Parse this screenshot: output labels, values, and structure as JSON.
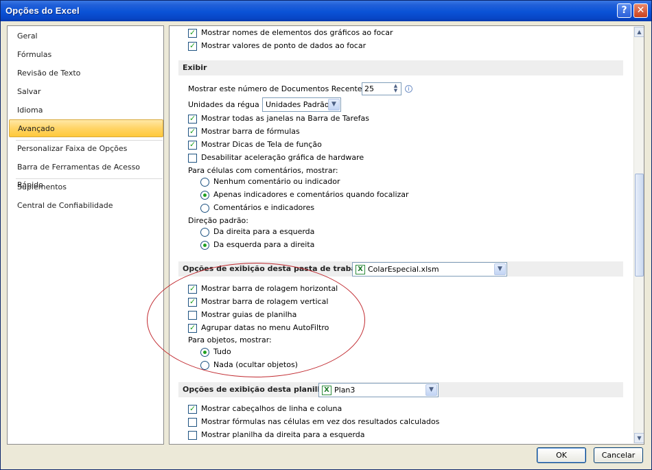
{
  "window": {
    "title": "Opções do Excel",
    "help_label": "?",
    "close_label": "✕"
  },
  "nav": {
    "items": [
      "Geral",
      "Fórmulas",
      "Revisão de Texto",
      "Salvar",
      "Idioma",
      "Avançado",
      "Personalizar Faixa de Opções",
      "Barra de Ferramentas de Acesso Rápido",
      "Suplementos",
      "Central de Confiabilidade"
    ],
    "active": "Avançado"
  },
  "charts_opts": {
    "show_element_names": {
      "label": "Mostrar nomes de elementos dos gráficos ao focar",
      "checked": true
    },
    "show_data_values": {
      "label": "Mostrar valores de ponto de dados  ao focar",
      "checked": true
    }
  },
  "display": {
    "header": "Exibir",
    "recent_docs_label": "Mostrar este número de Documentos Recentes:",
    "recent_docs_value": "25",
    "ruler_units_label": "Unidades da régua",
    "ruler_units_value": "Unidades Padrão",
    "opt_all_windows": {
      "label": "Mostrar todas as janelas na Barra de Tarefas",
      "checked": true
    },
    "opt_formula_bar": {
      "label": "Mostrar barra de fórmulas",
      "checked": true
    },
    "opt_function_tips": {
      "label": "Mostrar Dicas de Tela de função",
      "checked": true
    },
    "opt_disable_hw_accel": {
      "label": "Desabilitar aceleração gráfica de hardware",
      "checked": false
    },
    "comments_label": "Para células com comentários, mostrar:",
    "comments_options": [
      "Nenhum comentário ou indicador",
      "Apenas indicadores e comentários quando focalizar",
      "Comentários e indicadores"
    ],
    "comments_selected": 1,
    "direction_label": "Direção padrão:",
    "direction_options": [
      "Da direita para a esquerda",
      "Da esquerda para a direita"
    ],
    "direction_selected": 1
  },
  "workbook": {
    "header": "Opções de exibição desta pasta de trabalho:",
    "file": "ColarEspecial.xlsm",
    "opt_h_scroll": {
      "label": "Mostrar barra de rolagem horizontal",
      "checked": true
    },
    "opt_v_scroll": {
      "label": "Mostrar barra de rolagem vertical",
      "checked": true
    },
    "opt_sheet_tabs": {
      "label": "Mostrar guias de planilha",
      "checked": false
    },
    "opt_group_dates": {
      "label": "Agrupar datas no menu AutoFiltro",
      "checked": true
    },
    "objects_label": "Para objetos, mostrar:",
    "objects_options": [
      "Tudo",
      "Nada (ocultar objetos)"
    ],
    "objects_selected": 0
  },
  "sheet": {
    "header": "Opções de exibição desta planilha:",
    "sheet_name": "Plan3",
    "opt_headers": {
      "label": "Mostrar cabeçalhos de linha e coluna",
      "checked": true
    },
    "opt_formulas": {
      "label": "Mostrar fórmulas nas células em vez dos resultados calculados",
      "checked": false
    },
    "opt_rtl": {
      "label": "Mostrar planilha da direita para a esquerda",
      "checked": false
    }
  },
  "buttons": {
    "ok": "OK",
    "cancel": "Cancelar"
  },
  "colors": {
    "title_bar": "#0a52d6",
    "active_nav": "#ffd466",
    "check_mark": "#21a121",
    "annotation": "#c0272d"
  }
}
